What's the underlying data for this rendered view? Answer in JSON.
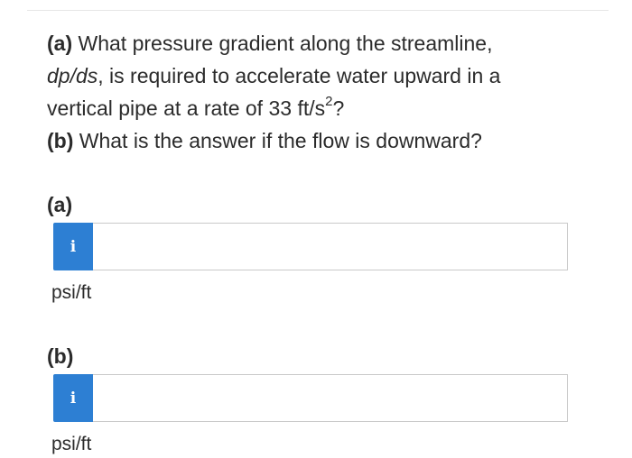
{
  "question": {
    "a_label": "(a)",
    "a_text_1": "What pressure gradient along the streamline,",
    "a_text_2_var": "dp/ds",
    "a_text_2_rest": ", is required to accelerate water upward in a",
    "a_text_3": "vertical pipe at a rate of 33 ft/s",
    "a_text_3_sup": "2",
    "a_text_3_end": "?",
    "b_label": "(b)",
    "b_text": "What is the answer if the flow is downward?"
  },
  "parts": [
    {
      "label": "(a)",
      "info_icon": "i",
      "input_value": "",
      "unit": "psi/ft"
    },
    {
      "label": "(b)",
      "info_icon": "i",
      "input_value": "",
      "unit": "psi/ft"
    }
  ],
  "colors": {
    "info_button": "#2d7fd3",
    "text": "#2b2b2b",
    "input_border": "#c9c9c9"
  }
}
